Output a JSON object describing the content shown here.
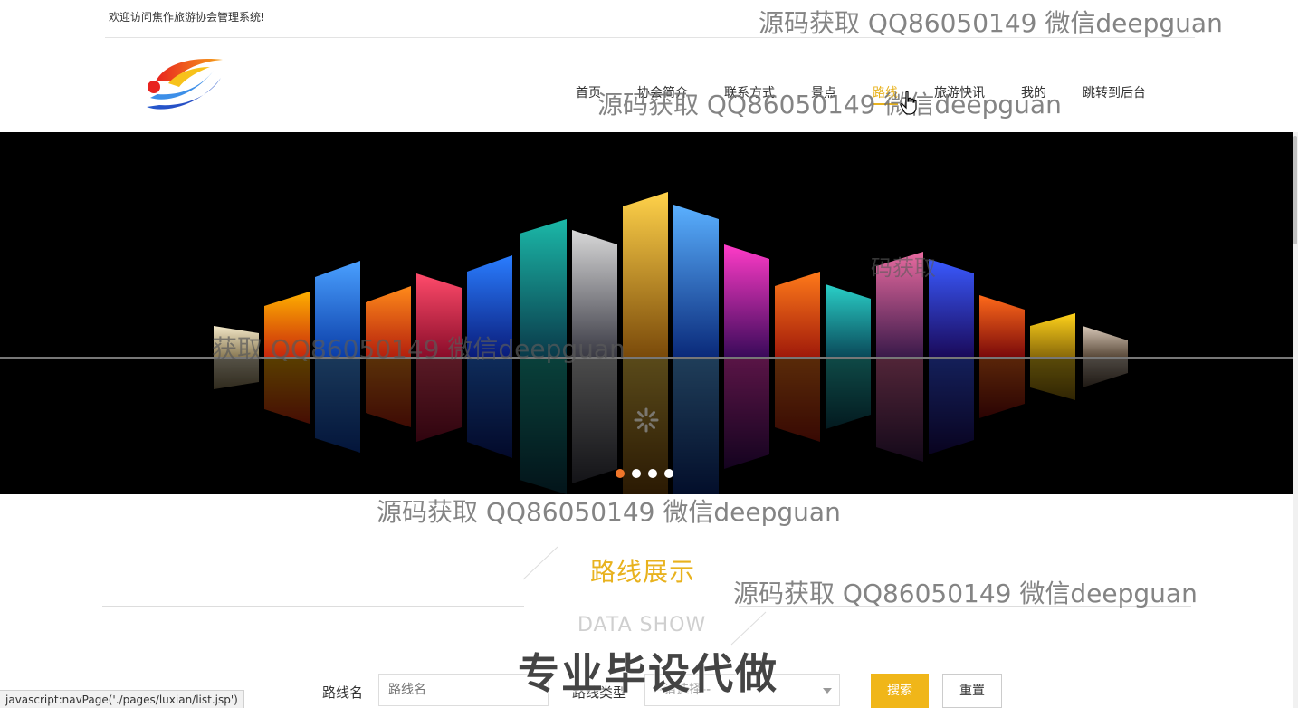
{
  "topbar": {
    "welcome_text": "欢迎访问焦作旅游协会管理系统!"
  },
  "nav": {
    "items": [
      {
        "label": "首页"
      },
      {
        "label": "协会简介"
      },
      {
        "label": "联系方式"
      },
      {
        "label": "景点"
      },
      {
        "label": "路线",
        "active": true
      },
      {
        "label": "旅游快讯"
      },
      {
        "label": "我的"
      },
      {
        "label": "跳转到后台"
      }
    ],
    "active_color": "#e8b21e"
  },
  "banner": {
    "slide_count": 4,
    "active_index": 0,
    "active_dot_color": "#f0762a"
  },
  "section": {
    "title": "路线展示",
    "subtitle": "DATA SHOW",
    "title_color": "#e8b21e"
  },
  "search": {
    "name_label": "路线名",
    "name_placeholder": "路线名",
    "type_label": "路线类型",
    "type_selected": "--请选择--",
    "search_button": "搜索",
    "reset_button": "重置",
    "button_color": "#f0b619"
  },
  "watermarks": {
    "text": "源码获取 QQ86050149 微信deepguan",
    "partial_1": "获取 QQ86050149 微信deepguan",
    "partial_2": "码获取",
    "promo": "专业毕设代做"
  },
  "statusbar": {
    "url": "javascript:navPage('./pages/luxian/list.jsp')"
  }
}
